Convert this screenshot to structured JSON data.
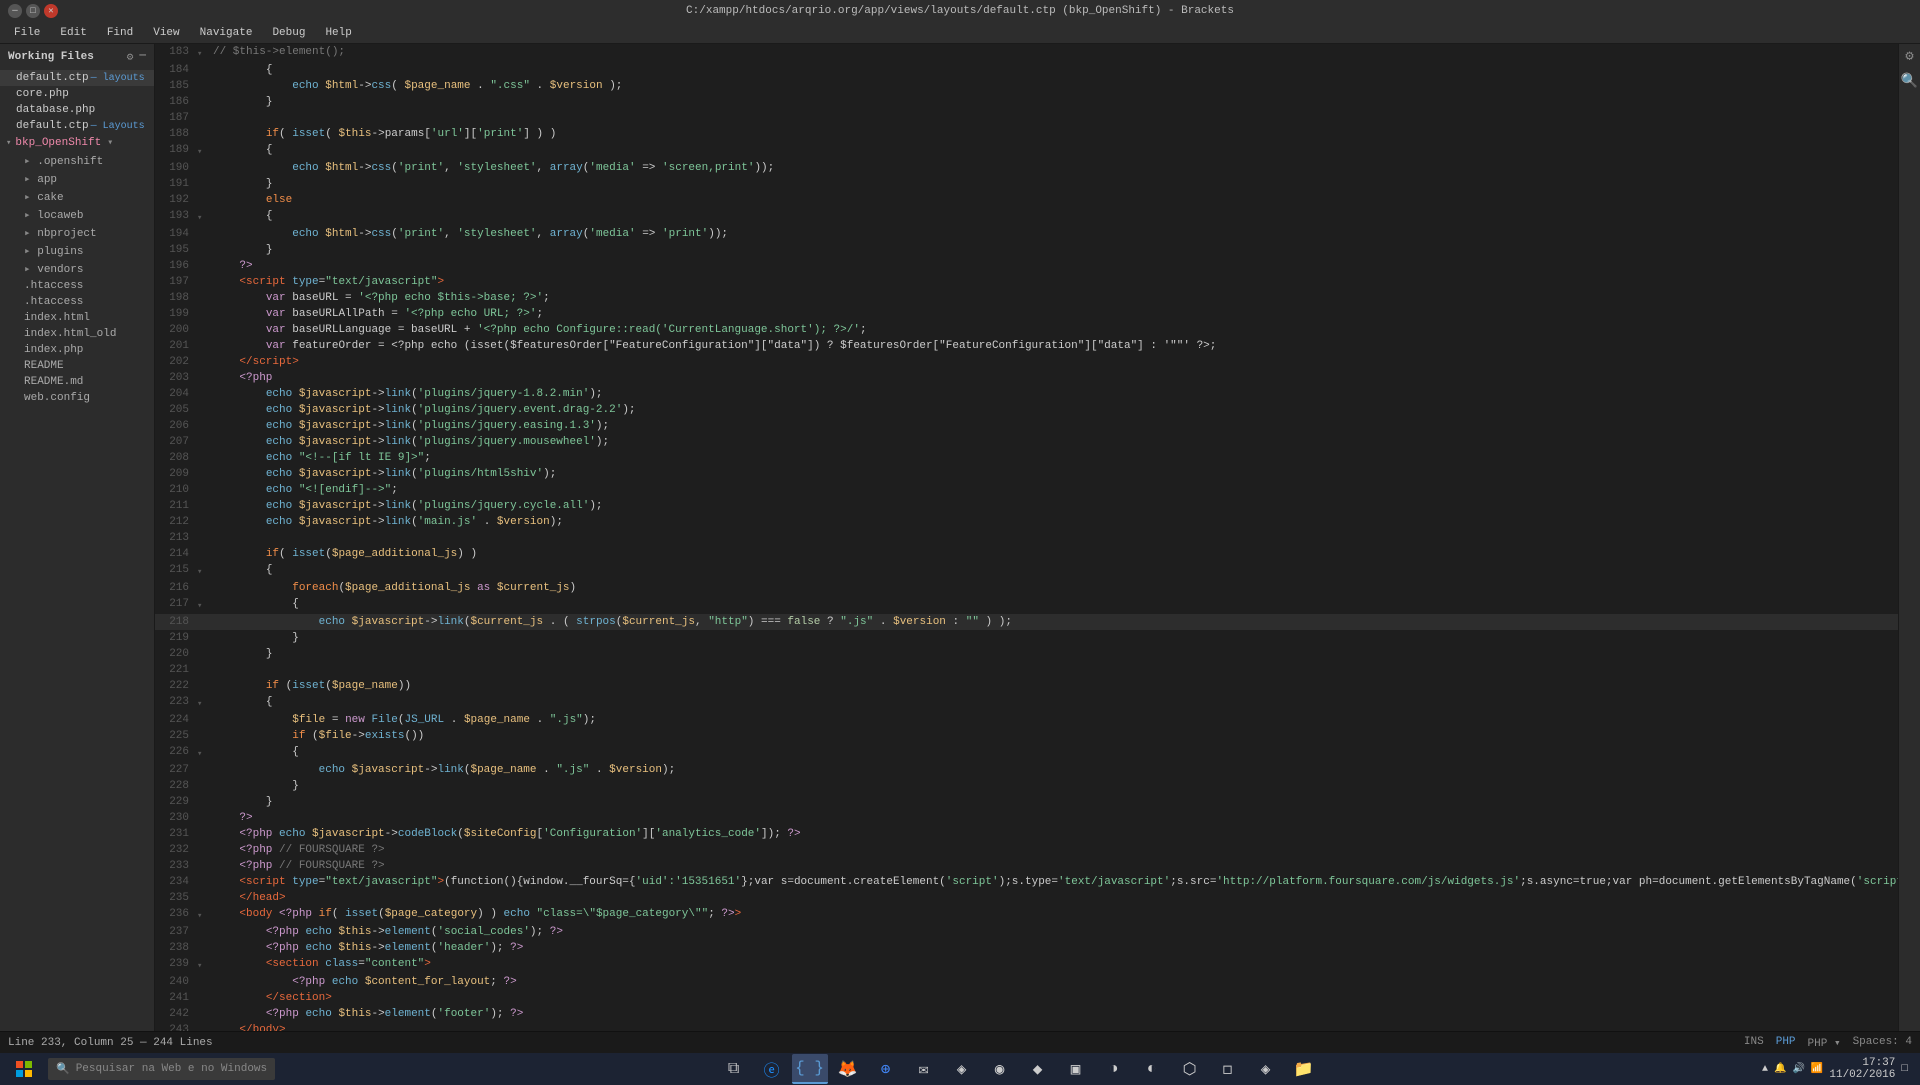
{
  "titlebar": {
    "title": "C:/xampp/htdocs/arqrio.org/app/views/layouts/default.ctp (bkp_OpenShift) - Brackets",
    "min_label": "─",
    "max_label": "□",
    "close_label": "✕"
  },
  "menubar": {
    "items": [
      "File",
      "Edit",
      "Find",
      "View",
      "Navigate",
      "Debug",
      "Help"
    ]
  },
  "sidebar": {
    "working_files_label": "Working Files",
    "files": [
      {
        "name": "default.ctp",
        "label": "— layouts",
        "active": true
      },
      {
        "name": "core.php",
        "label": ""
      },
      {
        "name": "database.php",
        "label": ""
      },
      {
        "name": "default.ctp",
        "label": "— Layouts"
      }
    ],
    "project": {
      "name": "bkp_OpenShift",
      "items": [
        {
          "type": "folder",
          "name": ".openshift",
          "indent": 1
        },
        {
          "type": "folder",
          "name": "app",
          "indent": 1
        },
        {
          "type": "folder",
          "name": "cake",
          "indent": 1
        },
        {
          "type": "folder",
          "name": "locaweb",
          "indent": 1
        },
        {
          "type": "folder",
          "name": "nbproject",
          "indent": 1
        },
        {
          "type": "folder",
          "name": "plugins",
          "indent": 1
        },
        {
          "type": "folder",
          "name": "vendors",
          "indent": 1
        },
        {
          "type": "file",
          "name": ".htaccess",
          "indent": 1
        },
        {
          "type": "file",
          "name": ".htaccess",
          "indent": 1
        },
        {
          "type": "file",
          "name": "index.html",
          "indent": 1
        },
        {
          "type": "file",
          "name": "index.html_old",
          "indent": 1
        },
        {
          "type": "file",
          "name": "index.php",
          "indent": 1
        },
        {
          "type": "file",
          "name": "README",
          "indent": 1
        },
        {
          "type": "file",
          "name": "README.md",
          "indent": 1
        },
        {
          "type": "file",
          "name": "web.config",
          "indent": 1
        }
      ]
    }
  },
  "statusbar": {
    "cursor": "Line 233, Column 25 — 244 Lines",
    "ins": "INS",
    "lang": "PHP",
    "spaces": "Spaces: 4"
  },
  "taskbar": {
    "search_placeholder": "Pesquisar na Web e no Windows",
    "time": "17:37",
    "date": "11/02/2016"
  }
}
